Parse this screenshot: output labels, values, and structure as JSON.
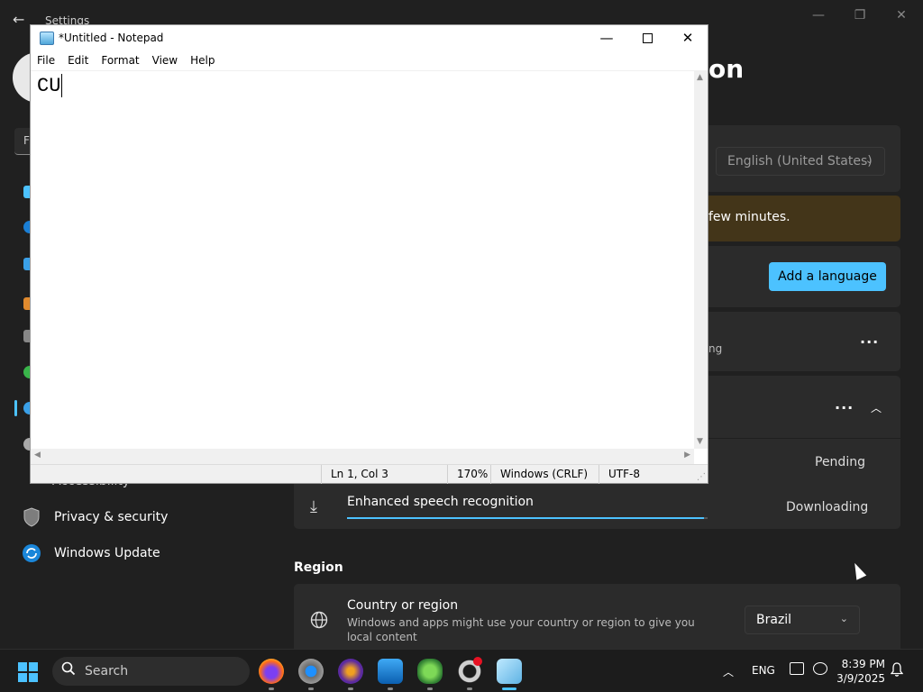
{
  "settings": {
    "window_title": "Settings",
    "back_icon": "arrow-left-icon",
    "find_placeholder_letter": "F",
    "page_heading_partial": "on",
    "sidebar": {
      "partial_item": "Accessibility",
      "items": [
        {
          "label": "Privacy & security",
          "icon": "shield-icon"
        },
        {
          "label": "Windows Update",
          "icon": "sync-icon"
        }
      ]
    },
    "language": {
      "display_language": "English (United States)",
      "warning_text": "few minutes.",
      "add_language_label": "Add a language",
      "partial_status": "ng"
    },
    "features": [
      {
        "status": "Pending"
      },
      {
        "label": "Enhanced speech recognition",
        "status": "Downloading",
        "progress": 0.99
      }
    ],
    "region": {
      "heading": "Region",
      "country_title": "Country or region",
      "country_desc": "Windows and apps might use your country or region to give you local content",
      "country_value": "Brazil"
    }
  },
  "notepad": {
    "title": "*Untitled - Notepad",
    "menu": [
      "File",
      "Edit",
      "Format",
      "View",
      "Help"
    ],
    "content": "CU",
    "status": {
      "position": "Ln 1, Col 3",
      "zoom": "170%",
      "line_ending": "Windows (CRLF)",
      "encoding": "UTF-8"
    }
  },
  "taskbar": {
    "search_label": "Search",
    "apps": [
      "firefox-icon",
      "settings-gear-icon",
      "krita-icon",
      "photos-icon",
      "frog-app-icon",
      "chrome-app-icon",
      "notepad-icon"
    ],
    "language_indicator": "ENG",
    "time": "8:39 PM",
    "date": "3/9/2025"
  },
  "colors": {
    "accent": "#4cc2ff",
    "settings_bg": "#202020",
    "card_bg": "#2b2b2b",
    "warning_bg": "#433519"
  }
}
